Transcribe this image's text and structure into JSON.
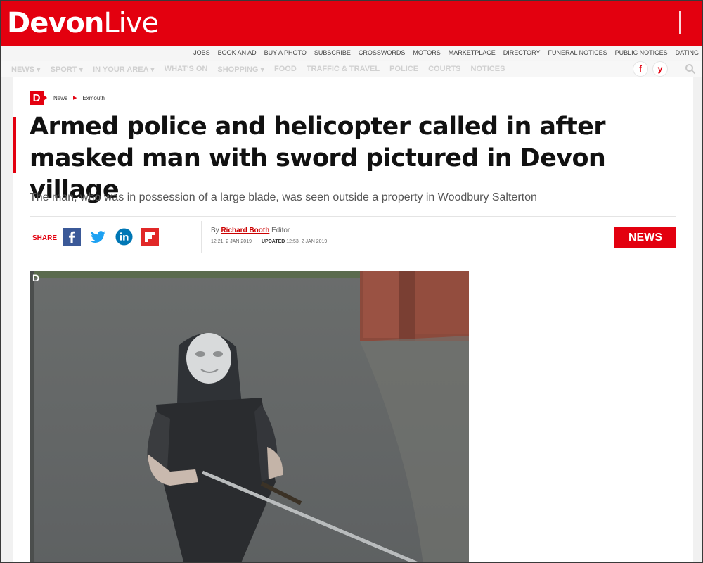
{
  "brand": {
    "name_bold": "Devon",
    "name_light": "Live"
  },
  "utility_links": [
    "JOBS",
    "BOOK AN AD",
    "BUY A PHOTO",
    "SUBSCRIBE",
    "CROSSWORDS",
    "MOTORS",
    "MARKETPLACE",
    "DIRECTORY",
    "FUNERAL NOTICES",
    "PUBLIC NOTICES",
    "DATING"
  ],
  "nav_items": [
    "NEWS ▾",
    "SPORT ▾",
    "IN YOUR AREA ▾",
    "WHAT'S ON",
    "SHOPPING ▾",
    "FOOD",
    "TRAFFIC & TRAVEL",
    "POLICE",
    "COURTS",
    "NOTICES"
  ],
  "social": {
    "facebook": "f",
    "twitter": "y"
  },
  "breadcrumb": {
    "badge": "D",
    "items": [
      "News",
      "Exmouth"
    ]
  },
  "article": {
    "headline": "Armed police and helicopter called in after masked man with sword pictured in Devon village",
    "standfirst": "The man, who was in possession of a large blade, was seen outside a property in Woodbury Salterton",
    "share_label": "SHARE",
    "byline_prefix": "By",
    "author": "Richard Booth",
    "author_role": "Editor",
    "published": "12:21, 2 JAN 2019",
    "updated_label": "UPDATED",
    "updated": "12:53, 2 JAN 2019",
    "category_badge": "NEWS"
  },
  "photo": {
    "watermark": "D"
  },
  "colors": {
    "brand_red": "#e3000f",
    "facebook": "#3b5998",
    "twitter": "#1da1f2",
    "linkedin": "#0077b5",
    "flipboard": "#e12828"
  },
  "icons": [
    "facebook-icon",
    "twitter-icon",
    "linkedin-icon",
    "flipboard-icon",
    "search-icon"
  ]
}
